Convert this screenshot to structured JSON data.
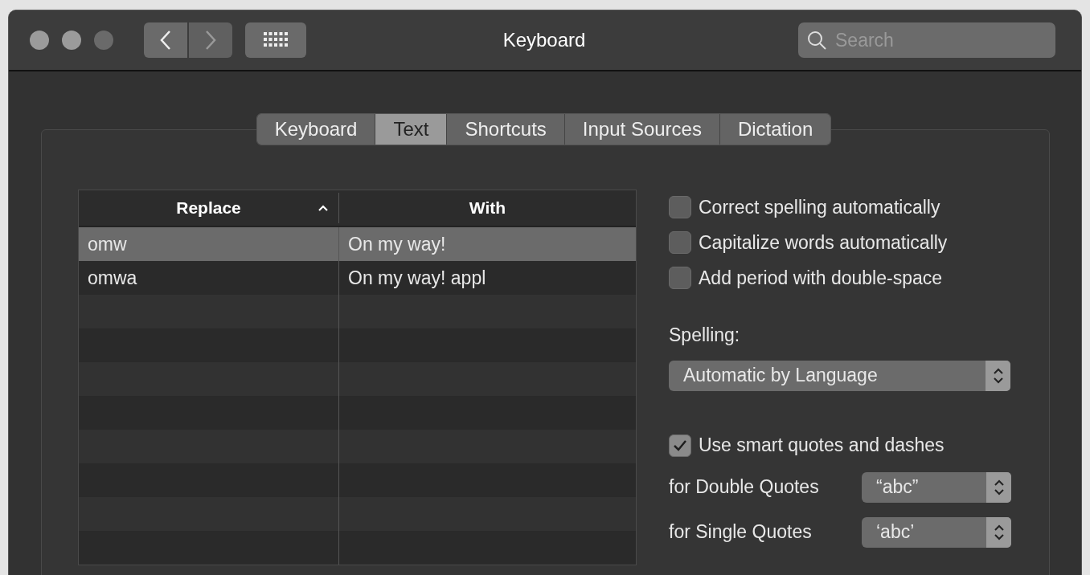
{
  "window": {
    "title": "Keyboard"
  },
  "toolbar": {
    "search": {
      "placeholder": "Search"
    }
  },
  "tabs": [
    {
      "label": "Keyboard",
      "selected": false
    },
    {
      "label": "Text",
      "selected": true
    },
    {
      "label": "Shortcuts",
      "selected": false
    },
    {
      "label": "Input Sources",
      "selected": false
    },
    {
      "label": "Dictation",
      "selected": false
    }
  ],
  "table": {
    "columns": [
      {
        "label": "Replace",
        "sorted": true
      },
      {
        "label": "With",
        "sorted": false
      }
    ],
    "rows": [
      {
        "cells": [
          "omw",
          "On my way!"
        ],
        "selected": true
      },
      {
        "cells": [
          "omwa",
          "On my way! appl"
        ],
        "selected": false
      }
    ]
  },
  "options": [
    {
      "label": "Correct spelling automatically",
      "checked": false
    },
    {
      "label": "Capitalize words automatically",
      "checked": false
    },
    {
      "label": "Add period with double-space",
      "checked": false
    }
  ],
  "spelling": {
    "label": "Spelling:",
    "value": "Automatic by Language"
  },
  "smart_quotes": {
    "label": "Use smart quotes and dashes",
    "checked": true
  },
  "quote_styles": [
    {
      "label": "for Double Quotes",
      "value": "“abc”"
    },
    {
      "label": "for Single Quotes",
      "value": "‘abc’"
    }
  ]
}
